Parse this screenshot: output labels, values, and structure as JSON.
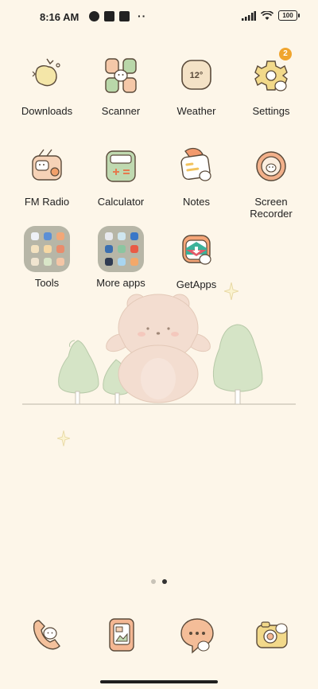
{
  "status_bar": {
    "time": "8:16 AM",
    "battery": "100"
  },
  "apps": [
    {
      "label": "Downloads",
      "icon": "downloads-icon"
    },
    {
      "label": "Scanner",
      "icon": "scanner-icon"
    },
    {
      "label": "Weather",
      "icon": "weather-icon",
      "text": "12°"
    },
    {
      "label": "Settings",
      "icon": "settings-icon",
      "badge": "2"
    },
    {
      "label": "FM Radio",
      "icon": "fm-radio-icon"
    },
    {
      "label": "Calculator",
      "icon": "calculator-icon"
    },
    {
      "label": "Notes",
      "icon": "notes-icon"
    },
    {
      "label": "Screen\nRecorder",
      "icon": "screen-recorder-icon"
    },
    {
      "label": "Tools",
      "icon": "tools-folder-icon"
    },
    {
      "label": "More apps",
      "icon": "more-apps-folder-icon"
    },
    {
      "label": "GetApps",
      "icon": "getapps-icon"
    }
  ],
  "dock": [
    {
      "icon": "phone-icon"
    },
    {
      "icon": "gallery-icon"
    },
    {
      "icon": "messages-icon"
    },
    {
      "icon": "camera-icon"
    }
  ],
  "pages": {
    "count": 2,
    "active": 2
  }
}
